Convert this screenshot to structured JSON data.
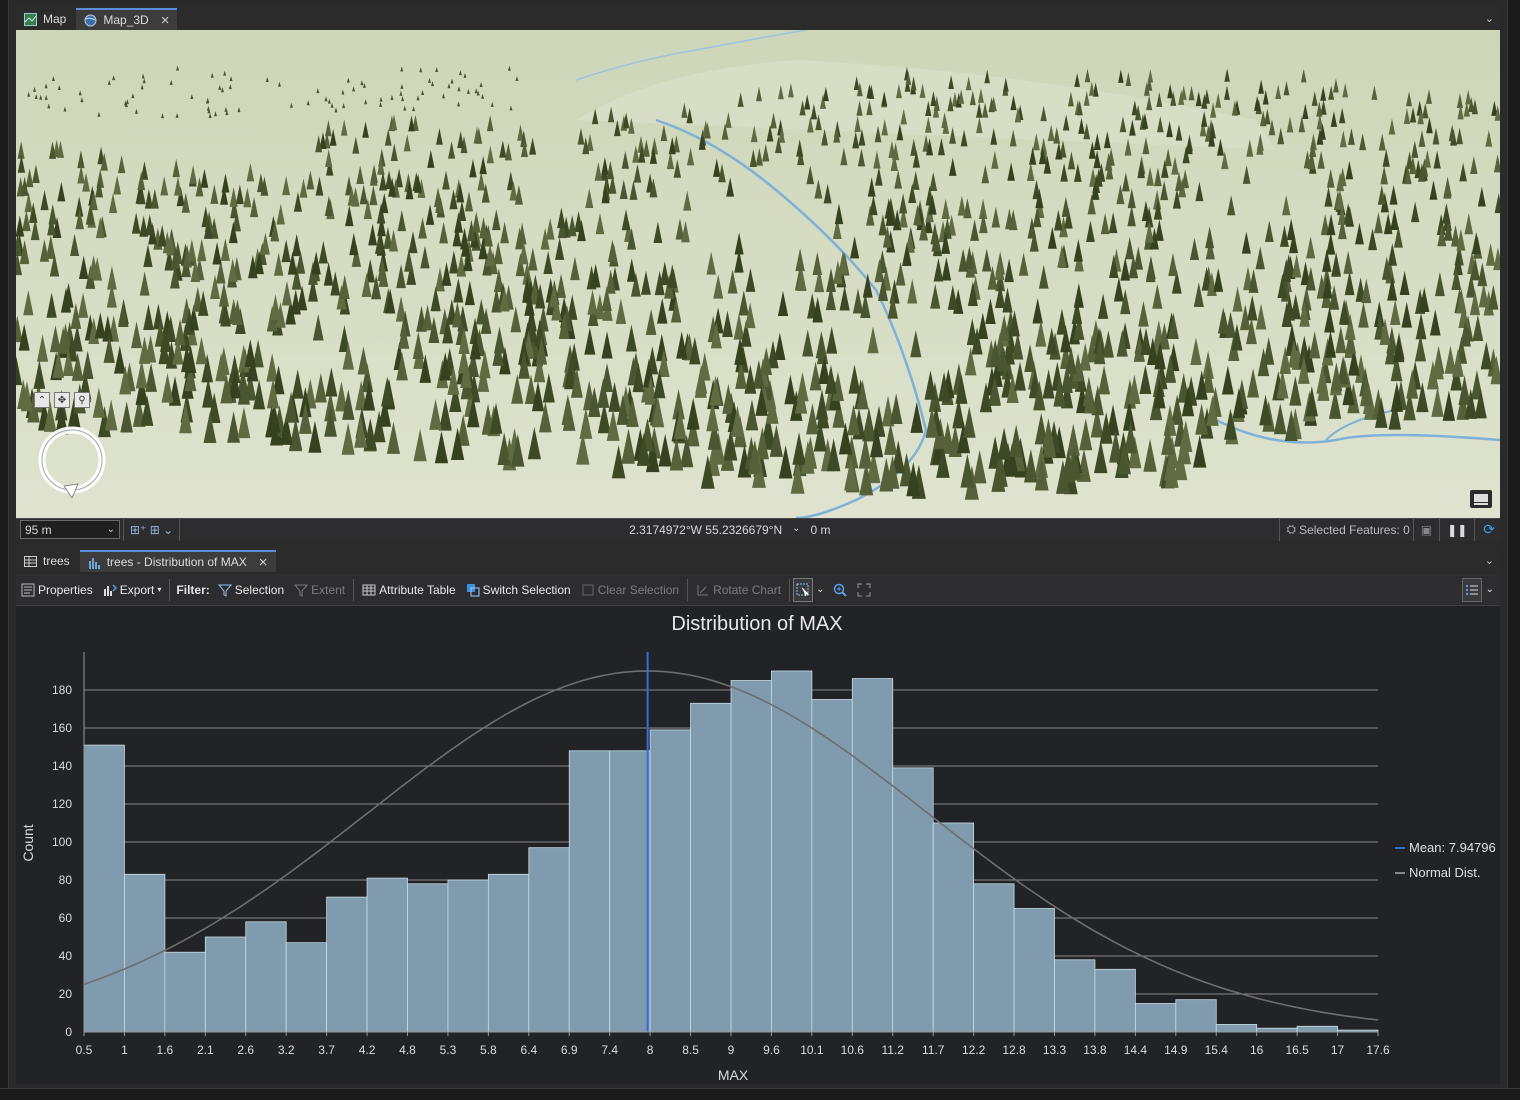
{
  "top_tabs": [
    {
      "label": "Map",
      "active": false
    },
    {
      "label": "Map_3D",
      "active": true
    }
  ],
  "map_status": {
    "scale": "95 m",
    "coordinates": "2.3174972°W 55.2326679°N",
    "elevation": "0 m",
    "selected_features": "Selected Features: 0"
  },
  "bottom_tabs": [
    {
      "label": "trees",
      "active": false
    },
    {
      "label": "trees - Distribution of MAX",
      "active": true
    }
  ],
  "toolbar": {
    "properties": "Properties",
    "export": "Export",
    "filter": "Filter:",
    "selection": "Selection",
    "extent": "Extent",
    "attribute_table": "Attribute Table",
    "switch_selection": "Switch Selection",
    "clear_selection": "Clear Selection",
    "rotate_chart": "Rotate Chart"
  },
  "colors": {
    "bar_fill": "#7f9bad",
    "bar_edge": "#c9dbe6",
    "mean_line": "#2f6fe0",
    "normal_curve": "#6e6e6e",
    "background": "#222327"
  },
  "chart_data": {
    "type": "bar",
    "title": "Distribution of MAX",
    "xlabel": "MAX",
    "ylabel": "Count",
    "ylim": [
      0,
      200
    ],
    "yticks": [
      0,
      20,
      40,
      60,
      80,
      100,
      120,
      140,
      160,
      180
    ],
    "xticks": [
      "0.5",
      "1",
      "1.6",
      "2.1",
      "2.6",
      "3.2",
      "3.7",
      "4.2",
      "4.8",
      "5.3",
      "5.8",
      "6.4",
      "6.9",
      "7.4",
      "8",
      "8.5",
      "9",
      "9.6",
      "10.1",
      "10.6",
      "11.2",
      "11.7",
      "12.2",
      "12.8",
      "13.3",
      "13.8",
      "14.4",
      "14.9",
      "15.4",
      "16",
      "16.5",
      "17",
      "17.6"
    ],
    "values": [
      151,
      83,
      42,
      50,
      58,
      47,
      71,
      81,
      78,
      80,
      83,
      97,
      148,
      148,
      159,
      173,
      185,
      190,
      175,
      186,
      139,
      110,
      78,
      65,
      38,
      33,
      15,
      17,
      4,
      2,
      3,
      1
    ],
    "mean": 7.94796,
    "normal_peak": 190,
    "normal_sd": 3.7,
    "legend": [
      {
        "name": "Mean: 7.94796"
      },
      {
        "name": "Normal Dist."
      }
    ],
    "legend_position": "right",
    "grid": true
  }
}
